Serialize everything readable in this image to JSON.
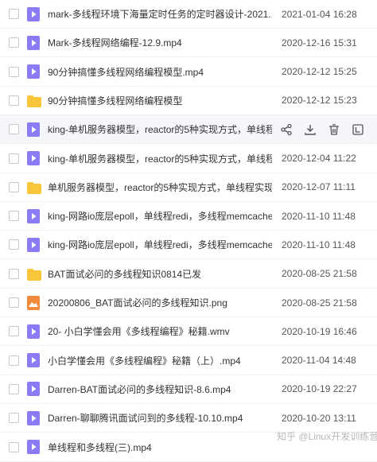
{
  "files": [
    {
      "name": "mark-多线程环境下海量定时任务的定时器设计-2021.1.2...",
      "date": "2021-01-04 16:28",
      "type": "video"
    },
    {
      "name": "Mark-多线程网络编程-12.9.mp4",
      "date": "2020-12-16 15:31",
      "type": "video"
    },
    {
      "name": "90分钟搞懂多线程网络编程模型.mp4",
      "date": "2020-12-12 15:25",
      "type": "video"
    },
    {
      "name": "90分钟搞懂多线程网络编程模型",
      "date": "2020-12-12 15:23",
      "type": "folder"
    },
    {
      "name": "king-单机服务器模型，reactor的5种实现方式，单线程...",
      "date": "",
      "type": "video",
      "hover": true
    },
    {
      "name": "king-单机服务器模型，reactor的5种实现方式，单线程...",
      "date": "2020-12-04 11:22",
      "type": "video"
    },
    {
      "name": "单机服务器模型，reactor的5种实现方式，单线程实现...",
      "date": "2020-12-07 11:11",
      "type": "folder"
    },
    {
      "name": "king-网路io庞层epoll，单线程redi，多线程memcache...",
      "date": "2020-11-10 11:48",
      "type": "video"
    },
    {
      "name": "king-网路io庞层epoll，单线程redi，多线程memcache...",
      "date": "2020-11-10 11:48",
      "type": "video"
    },
    {
      "name": "BAT面试必问的多线程知识0814已发",
      "date": "2020-08-25 21:58",
      "type": "folder"
    },
    {
      "name": "20200806_BAT面试必问的多线程知识.png",
      "date": "2020-08-25 21:58",
      "type": "image"
    },
    {
      "name": "20- 小白学懂会用《多线程编程》秘籍.wmv",
      "date": "2020-10-19 16:46",
      "type": "video"
    },
    {
      "name": "小白学懂会用《多线程编程》秘籍（上）.mp4",
      "date": "2020-11-04 14:48",
      "type": "video"
    },
    {
      "name": "Darren-BAT面试必问的多线程知识-8.6.mp4",
      "date": "2020-10-19 22:27",
      "type": "video"
    },
    {
      "name": "Darren-聊聊腾讯面试问到的多线程-10.10.mp4",
      "date": "2020-10-20 13:11",
      "type": "video"
    },
    {
      "name": "单线程和多线程(三).mp4",
      "date": "",
      "type": "video"
    }
  ],
  "hover_actions": [
    "share-icon",
    "download-icon",
    "delete-icon",
    "more-icon"
  ],
  "watermark": "知乎 @Linux开发训练营",
  "colors": {
    "video": "#8b7cf6",
    "folder": "#f9c53b",
    "image": "#f08a3c",
    "action": "#555555"
  }
}
